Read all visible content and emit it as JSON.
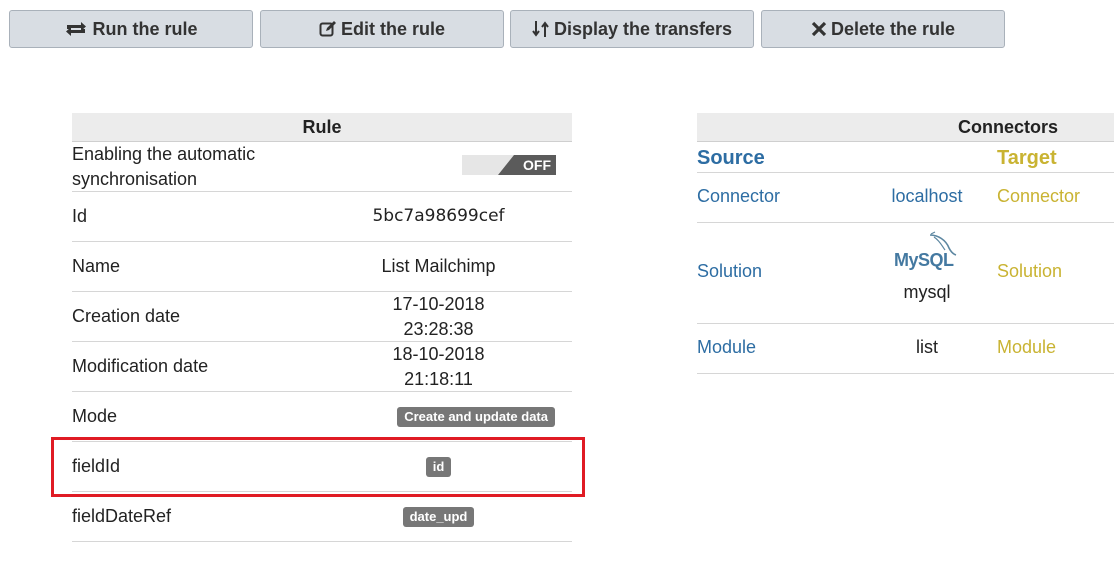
{
  "toolbar": {
    "run_label": "Run the rule",
    "edit_label": "Edit the rule",
    "display_label": "Display the transfers",
    "delete_label": "Delete the rule"
  },
  "rule": {
    "header": "Rule",
    "sync_label_line1": "Enabling the automatic",
    "sync_label_line2": "synchronisation",
    "sync_state": "OFF",
    "id_label": "Id",
    "id_value": "5bc7a98699cef",
    "name_label": "Name",
    "name_value": "List Mailchimp",
    "creation_label": "Creation date",
    "creation_date": "17-10-2018",
    "creation_time": "23:28:38",
    "modification_label": "Modification date",
    "modification_date": "18-10-2018",
    "modification_time": "21:18:11",
    "mode_label": "Mode",
    "mode_value": "Create and update data",
    "fieldid_label": "fieldId",
    "fieldid_value": "id",
    "fielddateref_label": "fieldDateRef",
    "fielddateref_value": "date_upd"
  },
  "connectors": {
    "header": "Connectors",
    "source_heading": "Source",
    "target_heading": "Target",
    "connector_label": "Connector",
    "connector_value": "localhost",
    "connector_target": "Connector",
    "solution_label": "Solution",
    "solution_logo_text": "MySQL",
    "solution_value": "mysql",
    "solution_target": "Solution",
    "module_label": "Module",
    "module_value": "list",
    "module_target": "Module"
  },
  "colors": {
    "source_blue": "#2d6da3",
    "target_gold": "#c9b332",
    "highlight_red": "#e01b24",
    "badge_gray": "#777777"
  }
}
